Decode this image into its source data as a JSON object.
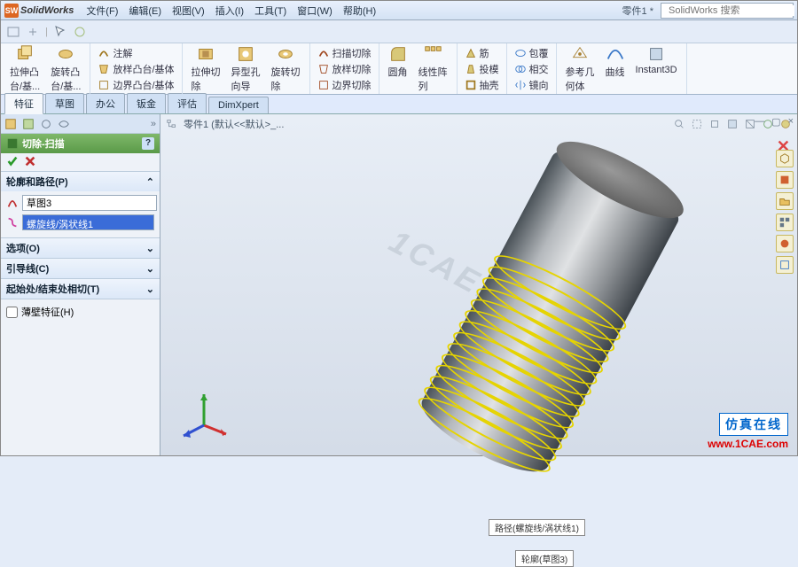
{
  "app": {
    "brand": "SolidWorks"
  },
  "doc": {
    "name": "零件1 *",
    "path": "零件1 (默认<<默认>_..."
  },
  "menu": [
    "文件(F)",
    "编辑(E)",
    "视图(V)",
    "插入(I)",
    "工具(T)",
    "窗口(W)",
    "帮助(H)"
  ],
  "search": {
    "placeholder": "SolidWorks 搜索"
  },
  "tabs": [
    "特征",
    "草图",
    "办公",
    "钣金",
    "评估",
    "DimXpert"
  ],
  "ribbon": {
    "big": [
      {
        "label": "拉伸凸\n台/基..."
      },
      {
        "label": "旋转凸\n台/基..."
      }
    ],
    "col1": [
      "注解",
      "放样凸台/基体",
      "边界凸台/基体"
    ],
    "big2": [
      {
        "label": "拉伸切\n除"
      },
      {
        "label": "异型孔\n向导"
      },
      {
        "label": "旋转切\n除"
      }
    ],
    "col2": [
      "扫描切除",
      "放样切除",
      "边界切除"
    ],
    "big3": [
      {
        "label": "圆角"
      },
      {
        "label": "线性阵\n列"
      }
    ],
    "col3": [
      "筋",
      "投模",
      "抽壳"
    ],
    "col4": [
      "包覆",
      "相交",
      "镜向"
    ],
    "big4": [
      {
        "label": "参考几\n何体"
      },
      {
        "label": "曲线"
      },
      {
        "label": "Instant3D"
      }
    ]
  },
  "pm": {
    "title": "切除-扫描",
    "help": "?",
    "sections": {
      "profile": {
        "title": "轮廓和路径(P)",
        "field1": "草图3",
        "field2": "螺旋线/涡状线1"
      },
      "options": {
        "title": "选项(O)"
      },
      "guide": {
        "title": "引导线(C)"
      },
      "startend": {
        "title": "起始处/结束处相切(T)"
      },
      "thin": {
        "label": "薄壁特征(H)"
      }
    }
  },
  "viewport": {
    "label1": "路径(螺旋线/涡状线1)",
    "label2": "轮廓(草图3)"
  },
  "watermark": {
    "center": "1CAE.COM",
    "cn": "仿真在线",
    "url": "www.1CAE.com"
  }
}
